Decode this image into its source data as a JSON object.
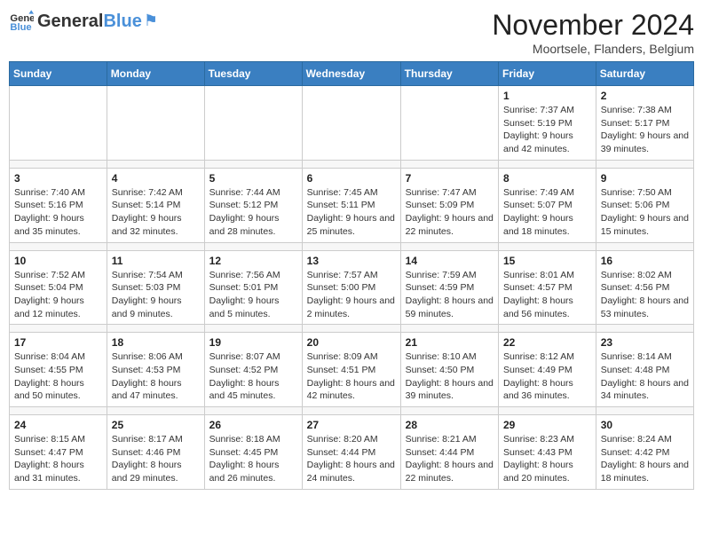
{
  "logo": {
    "text1": "General",
    "text2": "Blue"
  },
  "title": "November 2024",
  "subtitle": "Moortsele, Flanders, Belgium",
  "headers": [
    "Sunday",
    "Monday",
    "Tuesday",
    "Wednesday",
    "Thursday",
    "Friday",
    "Saturday"
  ],
  "weeks": [
    [
      {
        "day": "",
        "info": ""
      },
      {
        "day": "",
        "info": ""
      },
      {
        "day": "",
        "info": ""
      },
      {
        "day": "",
        "info": ""
      },
      {
        "day": "",
        "info": ""
      },
      {
        "day": "1",
        "info": "Sunrise: 7:37 AM\nSunset: 5:19 PM\nDaylight: 9 hours and 42 minutes."
      },
      {
        "day": "2",
        "info": "Sunrise: 7:38 AM\nSunset: 5:17 PM\nDaylight: 9 hours and 39 minutes."
      }
    ],
    [
      {
        "day": "3",
        "info": "Sunrise: 7:40 AM\nSunset: 5:16 PM\nDaylight: 9 hours and 35 minutes."
      },
      {
        "day": "4",
        "info": "Sunrise: 7:42 AM\nSunset: 5:14 PM\nDaylight: 9 hours and 32 minutes."
      },
      {
        "day": "5",
        "info": "Sunrise: 7:44 AM\nSunset: 5:12 PM\nDaylight: 9 hours and 28 minutes."
      },
      {
        "day": "6",
        "info": "Sunrise: 7:45 AM\nSunset: 5:11 PM\nDaylight: 9 hours and 25 minutes."
      },
      {
        "day": "7",
        "info": "Sunrise: 7:47 AM\nSunset: 5:09 PM\nDaylight: 9 hours and 22 minutes."
      },
      {
        "day": "8",
        "info": "Sunrise: 7:49 AM\nSunset: 5:07 PM\nDaylight: 9 hours and 18 minutes."
      },
      {
        "day": "9",
        "info": "Sunrise: 7:50 AM\nSunset: 5:06 PM\nDaylight: 9 hours and 15 minutes."
      }
    ],
    [
      {
        "day": "10",
        "info": "Sunrise: 7:52 AM\nSunset: 5:04 PM\nDaylight: 9 hours and 12 minutes."
      },
      {
        "day": "11",
        "info": "Sunrise: 7:54 AM\nSunset: 5:03 PM\nDaylight: 9 hours and 9 minutes."
      },
      {
        "day": "12",
        "info": "Sunrise: 7:56 AM\nSunset: 5:01 PM\nDaylight: 9 hours and 5 minutes."
      },
      {
        "day": "13",
        "info": "Sunrise: 7:57 AM\nSunset: 5:00 PM\nDaylight: 9 hours and 2 minutes."
      },
      {
        "day": "14",
        "info": "Sunrise: 7:59 AM\nSunset: 4:59 PM\nDaylight: 8 hours and 59 minutes."
      },
      {
        "day": "15",
        "info": "Sunrise: 8:01 AM\nSunset: 4:57 PM\nDaylight: 8 hours and 56 minutes."
      },
      {
        "day": "16",
        "info": "Sunrise: 8:02 AM\nSunset: 4:56 PM\nDaylight: 8 hours and 53 minutes."
      }
    ],
    [
      {
        "day": "17",
        "info": "Sunrise: 8:04 AM\nSunset: 4:55 PM\nDaylight: 8 hours and 50 minutes."
      },
      {
        "day": "18",
        "info": "Sunrise: 8:06 AM\nSunset: 4:53 PM\nDaylight: 8 hours and 47 minutes."
      },
      {
        "day": "19",
        "info": "Sunrise: 8:07 AM\nSunset: 4:52 PM\nDaylight: 8 hours and 45 minutes."
      },
      {
        "day": "20",
        "info": "Sunrise: 8:09 AM\nSunset: 4:51 PM\nDaylight: 8 hours and 42 minutes."
      },
      {
        "day": "21",
        "info": "Sunrise: 8:10 AM\nSunset: 4:50 PM\nDaylight: 8 hours and 39 minutes."
      },
      {
        "day": "22",
        "info": "Sunrise: 8:12 AM\nSunset: 4:49 PM\nDaylight: 8 hours and 36 minutes."
      },
      {
        "day": "23",
        "info": "Sunrise: 8:14 AM\nSunset: 4:48 PM\nDaylight: 8 hours and 34 minutes."
      }
    ],
    [
      {
        "day": "24",
        "info": "Sunrise: 8:15 AM\nSunset: 4:47 PM\nDaylight: 8 hours and 31 minutes."
      },
      {
        "day": "25",
        "info": "Sunrise: 8:17 AM\nSunset: 4:46 PM\nDaylight: 8 hours and 29 minutes."
      },
      {
        "day": "26",
        "info": "Sunrise: 8:18 AM\nSunset: 4:45 PM\nDaylight: 8 hours and 26 minutes."
      },
      {
        "day": "27",
        "info": "Sunrise: 8:20 AM\nSunset: 4:44 PM\nDaylight: 8 hours and 24 minutes."
      },
      {
        "day": "28",
        "info": "Sunrise: 8:21 AM\nSunset: 4:44 PM\nDaylight: 8 hours and 22 minutes."
      },
      {
        "day": "29",
        "info": "Sunrise: 8:23 AM\nSunset: 4:43 PM\nDaylight: 8 hours and 20 minutes."
      },
      {
        "day": "30",
        "info": "Sunrise: 8:24 AM\nSunset: 4:42 PM\nDaylight: 8 hours and 18 minutes."
      }
    ]
  ]
}
